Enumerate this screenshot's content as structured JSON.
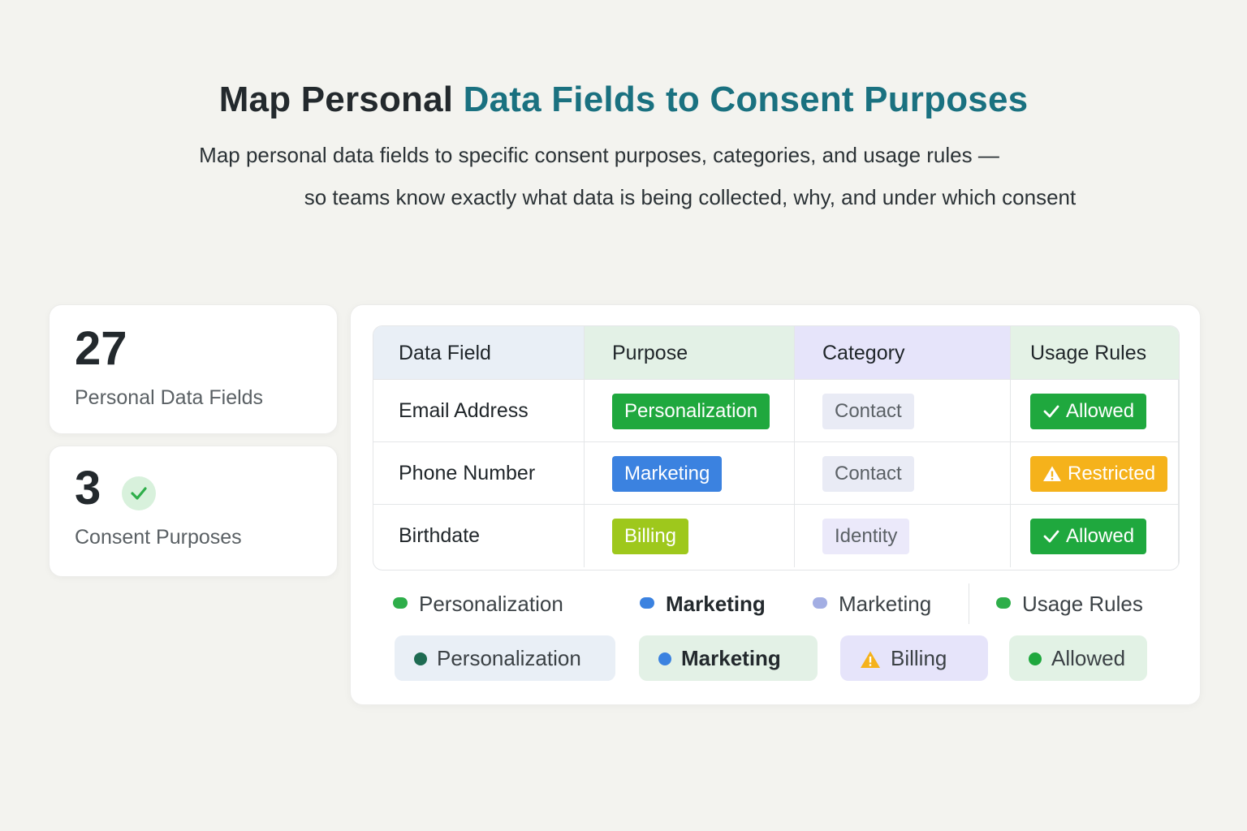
{
  "header": {
    "title_plain": "Map Personal",
    "title_accent": "Data Fields to Consent Purposes",
    "subtitle_line1": "Map personal data fields to specific consent purposes, categories, and usage rules —",
    "subtitle_line2": "so teams know exactly what data is being collected, why, and under which consent"
  },
  "stats": [
    {
      "value": "27",
      "label": "Personal Data Fields"
    },
    {
      "value": "3",
      "label": "Consent Purposes"
    }
  ],
  "table": {
    "columns": [
      "Data Field",
      "Purpose",
      "Category",
      "Usage Rules"
    ],
    "rows": [
      {
        "field": "Email Address",
        "purpose": "Personalization",
        "category": "Contact",
        "rule": "Allowed"
      },
      {
        "field": "Phone Number",
        "purpose": "Marketing",
        "category": "Contact",
        "rule": "Restricted"
      },
      {
        "field": "Birthdate",
        "purpose": "Billing",
        "category": "Identity",
        "rule": "Allowed"
      }
    ]
  },
  "legend": [
    {
      "label": "Personalization",
      "color": "#2eae4a"
    },
    {
      "label": "Marketing",
      "color": "#3b82e0"
    },
    {
      "label": "Marketing",
      "color": "#a3aee3"
    },
    {
      "label": "Usage Rules",
      "color": "#2eae4a"
    }
  ],
  "chips": [
    {
      "label": "Personalization",
      "icon": "dot-icon",
      "bg": "#e9eff6"
    },
    {
      "label": "Marketing",
      "icon": "dot-icon",
      "bg": "#e3f1e6"
    },
    {
      "label": "Billing",
      "icon": "warning-icon",
      "bg": "#e6e4fa"
    },
    {
      "label": "Allowed",
      "icon": "dot-icon",
      "bg": "#e2f2e5"
    }
  ],
  "colors": {
    "title_accent": "#1a7180",
    "personalization": "#1fa83e",
    "marketing": "#3b82e0",
    "billing": "#9ec81c",
    "allowed": "#1fa83e",
    "restricted": "#f5b21b"
  }
}
